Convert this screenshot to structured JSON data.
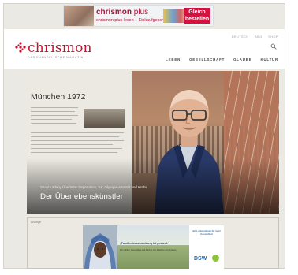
{
  "top_ad": {
    "brand": "chrismon",
    "brand_plus": "plus",
    "subline": "chrismon plus lesen – Einkaufgeschenk sichern",
    "cta_line1": "Gleich",
    "cta_line2": "bestellen",
    "colors": {
      "brand": "#b2123b",
      "cta": "#d3123f"
    }
  },
  "header": {
    "logo": "chrismon",
    "tagline": "DAS EVANGELISCHE MAGAZIN",
    "utility": [
      "DEUTSCH",
      "ABO",
      "SHOP"
    ],
    "search_icon": "search-icon",
    "nav": [
      "LEBEN",
      "GESELLSCHAFT",
      "GLAUBE",
      "KULTUR"
    ],
    "colors": {
      "logo": "#c8102e"
    }
  },
  "hero": {
    "panel_title": "München 1972",
    "kicker": "Shaul Ladany Überlebte Deportation, KZ, Olympia-Attentat und Krebs",
    "headline": "Der Überlebenskünstler"
  },
  "bottom_ad": {
    "label": "Anzeige",
    "quote": "„Familienbeschränkung ist gesund.“",
    "body": "Wir stärken Gesundheit und Rechte von Mädchen und Frauen",
    "side_text": "Jetzt unterstützen für mehr Gesundheit",
    "logo": "DSW"
  }
}
